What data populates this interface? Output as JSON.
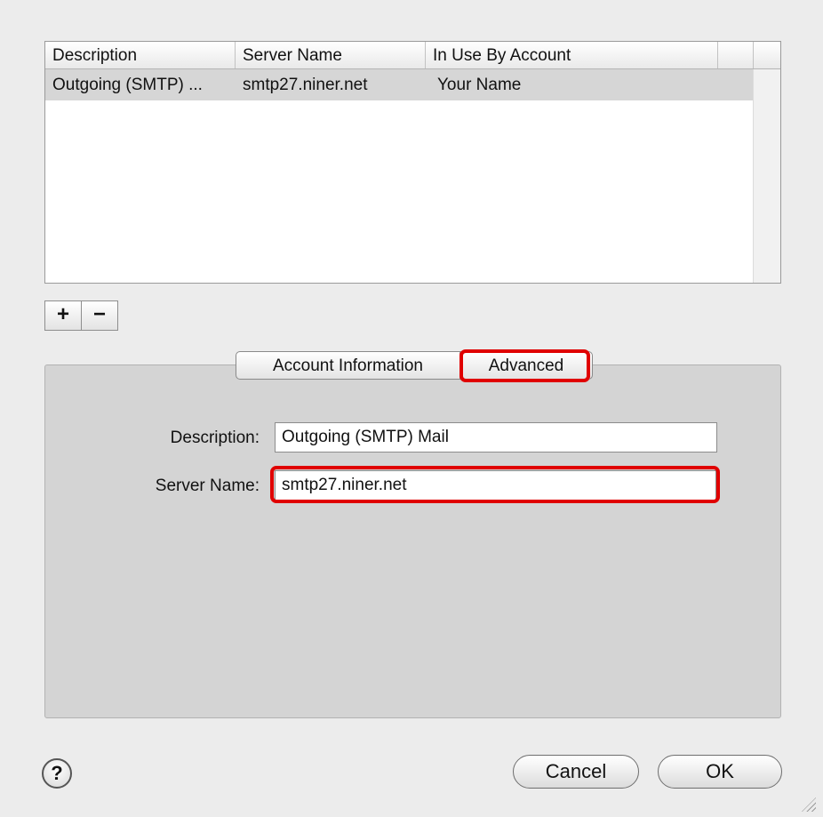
{
  "table": {
    "columns": [
      "Description",
      "Server Name",
      "In Use By Account"
    ],
    "rows": [
      {
        "description": "Outgoing (SMTP) ...",
        "server_name": "smtp27.niner.net",
        "in_use_by": "Your Name"
      }
    ]
  },
  "list_controls": {
    "add_label": "+",
    "remove_label": "−"
  },
  "tabs": [
    {
      "label": "Account Information",
      "selected": false
    },
    {
      "label": "Advanced",
      "selected": true
    }
  ],
  "form": {
    "description_label": "Description:",
    "description_value": "Outgoing (SMTP) Mail",
    "server_name_label": "Server Name:",
    "server_name_value": "smtp27.niner.net"
  },
  "buttons": {
    "help": "?",
    "cancel": "Cancel",
    "ok": "OK"
  },
  "colors": {
    "highlight": "#e00000",
    "selected_row": "#d6d6d6",
    "panel": "#d4d4d4"
  }
}
